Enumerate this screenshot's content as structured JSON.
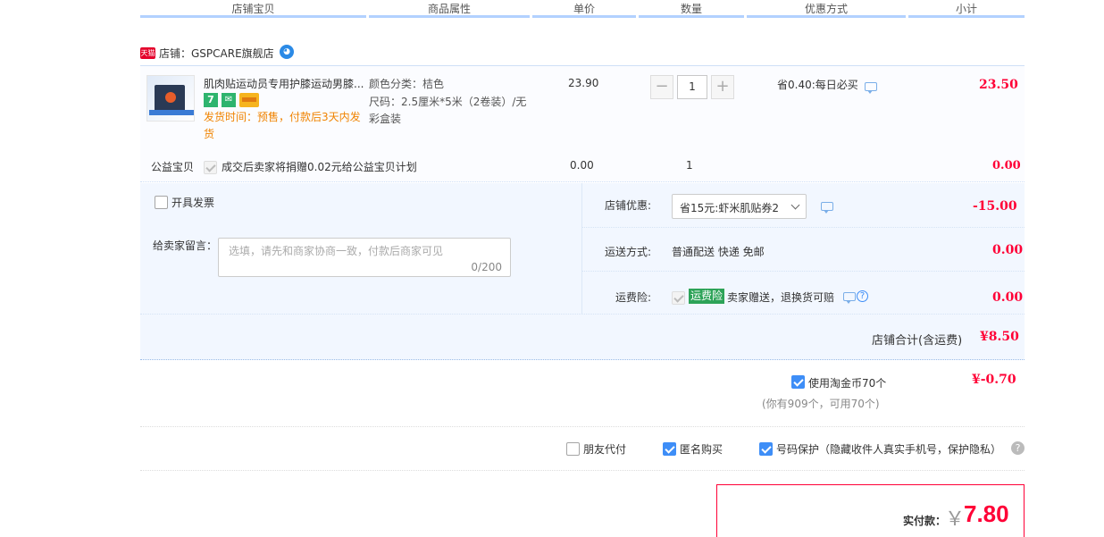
{
  "header": {
    "columns": [
      "店铺宝贝",
      "商品属性",
      "单价",
      "数量",
      "优惠方式",
      "小计"
    ]
  },
  "shop": {
    "badge": "天猫",
    "label": "店铺：GSPCARE旗舰店"
  },
  "item": {
    "title": "肌肉贴运动员专用护膝运动男膝...",
    "ship_time_line1": "发货时间：预售，付款后3天内发",
    "ship_time_line2": "货",
    "attr_color": "颜色分类：桔色",
    "attr_size_line1": "尺码：2.5厘米*5米（2卷装）/无",
    "attr_size_line2": "彩盒装",
    "unit_price": "23.90",
    "quantity": "1",
    "discount": "省0.40:每日必买",
    "subtotal": "23.50",
    "tag7": "7"
  },
  "charity": {
    "label": "公益宝贝",
    "text": "成交后卖家将捐赠0.02元给公益宝贝计划",
    "price": "0.00",
    "qty": "1",
    "subtotal": "0.00"
  },
  "invoice": {
    "label": "开具发票"
  },
  "message": {
    "label": "给卖家留言：",
    "placeholder": "选填，请先和商家协商一致，付款后商家可见",
    "counter": "0/200"
  },
  "shop_discount": {
    "label": "店铺优惠:",
    "selected": "省15元:虾米肌贴券2",
    "amount": "-15.00"
  },
  "shipping": {
    "label": "运送方式:",
    "value": "普通配送 快递 免邮",
    "amount": "0.00"
  },
  "insurance": {
    "label": "运费险:",
    "tag": "运费险",
    "text": "卖家赠送，退换货可赔",
    "amount": "0.00"
  },
  "shop_total": {
    "label": "店铺合计(含运费)",
    "amount": "¥8.50"
  },
  "coins": {
    "label": "使用淘金币70个",
    "sub": "(你有909个，可用70个)",
    "amount": "¥-0.70"
  },
  "options": {
    "friend_pay": "朋友代付",
    "anonymous": "匿名购买",
    "privacy": "号码保护（隐藏收件人真实手机号，保护隐私）"
  },
  "payment": {
    "label": "实付款：",
    "currency": "￥",
    "amount": "7.80"
  },
  "colors": {
    "accent_red": "#ff0036",
    "header_border": "#b2d1ff",
    "panel_bg": "#f2f7ff",
    "checkbox_blue": "#3e8ef7"
  }
}
